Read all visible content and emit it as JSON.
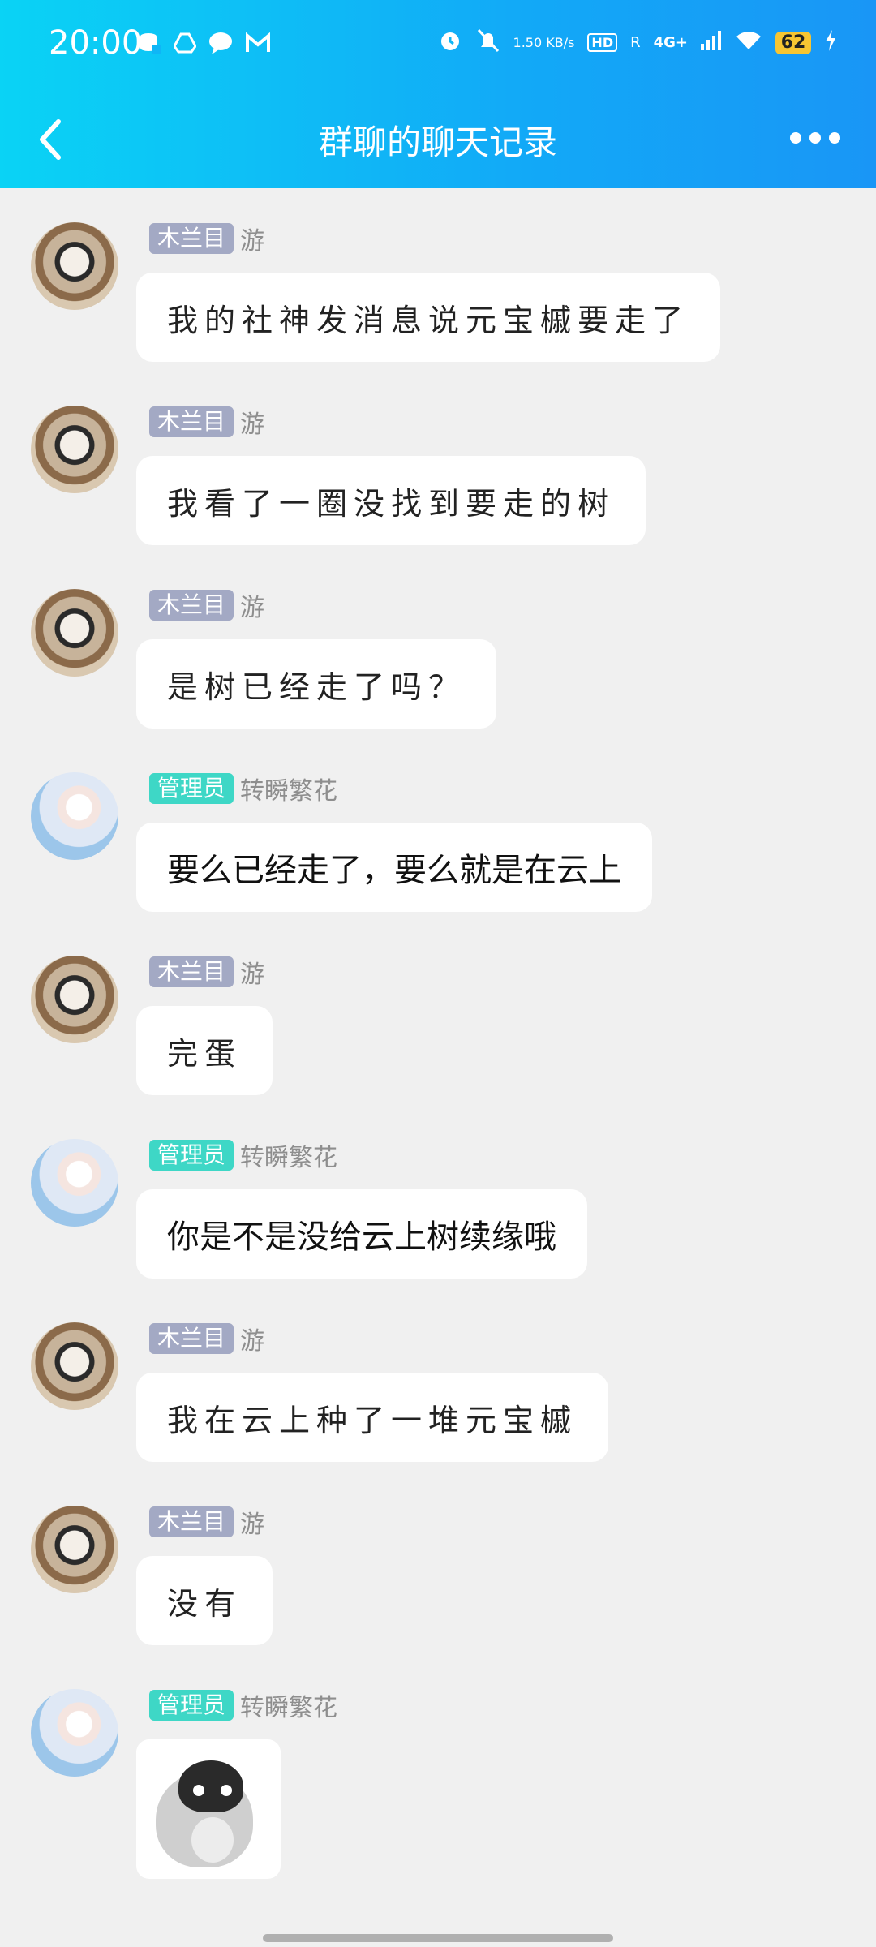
{
  "status_bar": {
    "time": "20:00",
    "net_speed": "1.50 KB/s",
    "hd": "HD",
    "roaming": "R",
    "network": "4G+",
    "battery": "62",
    "left_icons": [
      "database-icon",
      "drive-icon",
      "message-icon",
      "gmail-icon"
    ],
    "right_icons": [
      "alarm-icon",
      "mute-bell-icon",
      "signal-icon",
      "wifi-icon",
      "charging-icon"
    ]
  },
  "header": {
    "title": "群聊的聊天记录"
  },
  "messages": [
    {
      "badge": "木兰目",
      "badge_type": "member",
      "nick": "游",
      "text": "我的社神发消息说元宝槭要走了",
      "style": "hand"
    },
    {
      "badge": "木兰目",
      "badge_type": "member",
      "nick": "游",
      "text": "我看了一圈没找到要走的树",
      "style": "hand"
    },
    {
      "badge": "木兰目",
      "badge_type": "member",
      "nick": "游",
      "text": "是树已经走了吗？",
      "style": "hand"
    },
    {
      "badge": "管理员",
      "badge_type": "admin",
      "nick": "转瞬繁花",
      "text": "要么已经走了，要么就是在云上",
      "style": "plain"
    },
    {
      "badge": "木兰目",
      "badge_type": "member",
      "nick": "游",
      "text": "完蛋",
      "style": "hand"
    },
    {
      "badge": "管理员",
      "badge_type": "admin",
      "nick": "转瞬繁花",
      "text": "你是不是没给云上树续缘哦",
      "style": "plain"
    },
    {
      "badge": "木兰目",
      "badge_type": "member",
      "nick": "游",
      "text": "我在云上种了一堆元宝槭",
      "style": "hand"
    },
    {
      "badge": "木兰目",
      "badge_type": "member",
      "nick": "游",
      "text": "没有",
      "style": "hand"
    },
    {
      "badge": "管理员",
      "badge_type": "admin",
      "nick": "转瞬繁花",
      "text": "",
      "style": "sticker"
    }
  ]
}
